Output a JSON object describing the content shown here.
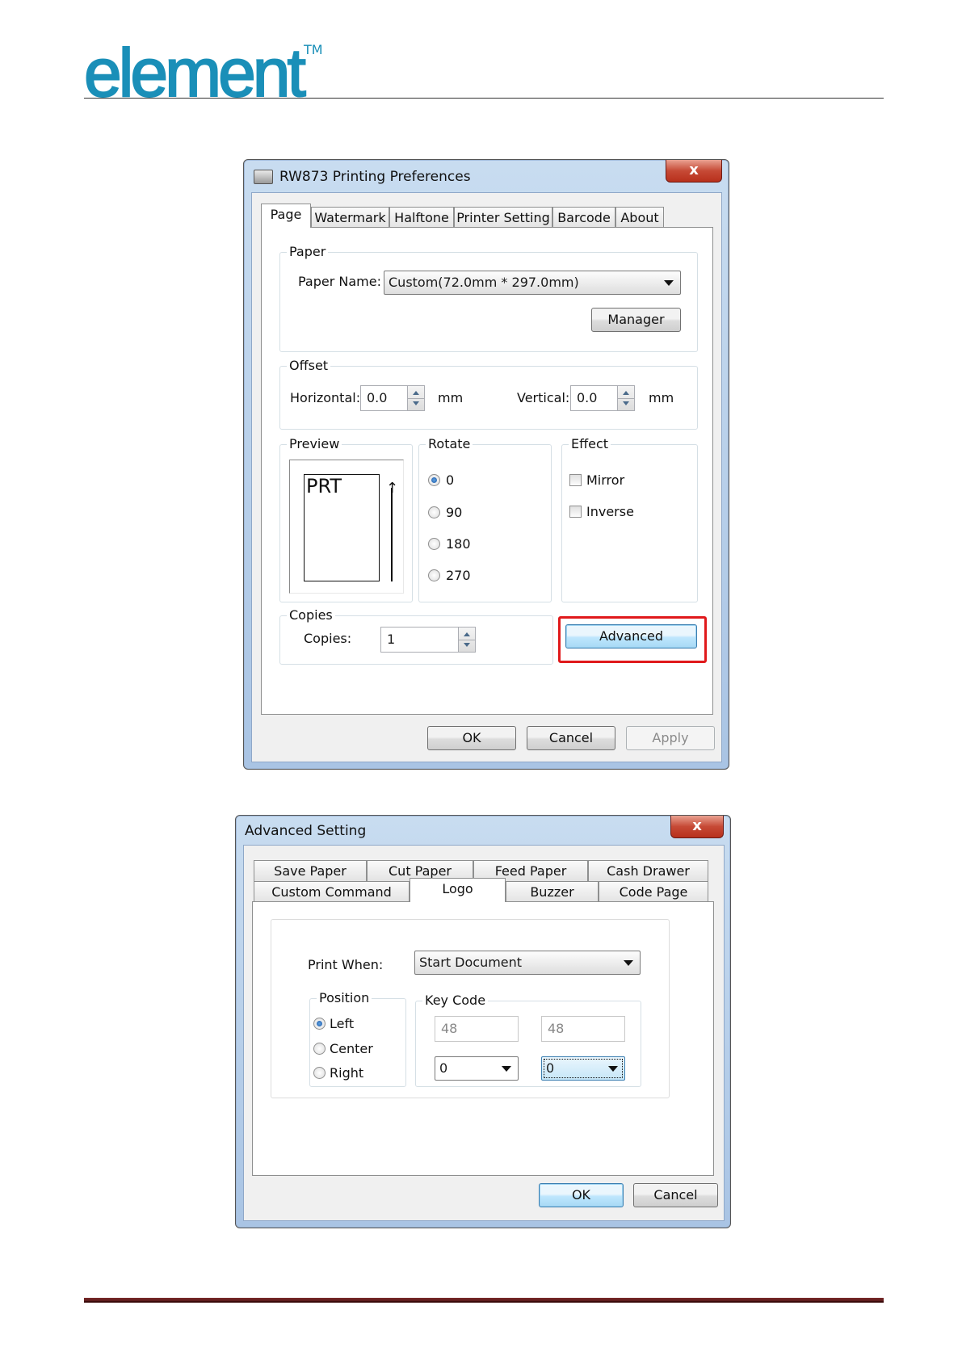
{
  "header": {
    "logo_text": "element",
    "logo_tm": "TM",
    "brand_color": "#1a8fb8"
  },
  "prefs_dialog": {
    "title": "RW873 Printing Preferences",
    "close_label": "x",
    "tabs": [
      "Page",
      "Watermark",
      "Halftone",
      "Printer Setting",
      "Barcode",
      "About"
    ],
    "active_tab": "Page",
    "paper": {
      "group_label": "Paper",
      "name_label": "Paper Name:",
      "name_value": "Custom(72.0mm * 297.0mm)",
      "manager_button": "Manager"
    },
    "offset": {
      "group_label": "Offset",
      "horizontal_label": "Horizontal:",
      "horizontal_value": "0.0",
      "horizontal_unit": "mm",
      "vertical_label": "Vertical:",
      "vertical_value": "0.0",
      "vertical_unit": "mm"
    },
    "preview": {
      "group_label": "Preview",
      "text": "PRT"
    },
    "rotate": {
      "group_label": "Rotate",
      "options": [
        "0",
        "90",
        "180",
        "270"
      ],
      "selected": "0"
    },
    "effect": {
      "group_label": "Effect",
      "mirror_label": "Mirror",
      "inverse_label": "Inverse",
      "mirror_checked": false,
      "inverse_checked": false
    },
    "copies": {
      "group_label": "Copies",
      "copies_label": "Copies:",
      "copies_value": "1"
    },
    "advanced_button": "Advanced",
    "highlight_color": "#e0191b",
    "ok_button": "OK",
    "cancel_button": "Cancel",
    "apply_button": "Apply"
  },
  "advanced_dialog": {
    "title": "Advanced Setting",
    "close_label": "x",
    "tabs_row1": [
      "Save Paper",
      "Cut Paper",
      "Feed Paper",
      "Cash Drawer"
    ],
    "tabs_row2": [
      "Custom Command",
      "Logo",
      "Buzzer",
      "Code Page"
    ],
    "active_tab": "Logo",
    "print_when_label": "Print When:",
    "print_when_value": "Start Document",
    "position": {
      "group_label": "Position",
      "options": [
        "Left",
        "Center",
        "Right"
      ],
      "selected": "Left"
    },
    "key_code": {
      "group_label": "Key Code",
      "value1": "48",
      "value2": "48",
      "select1": "0",
      "select2": "0"
    },
    "ok_button": "OK",
    "cancel_button": "Cancel"
  }
}
